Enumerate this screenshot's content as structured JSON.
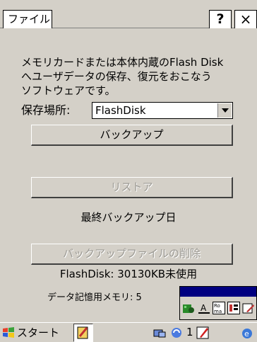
{
  "menu": {
    "file_label": "ファイル"
  },
  "titlebar": {
    "help_label": "?",
    "close_label": "×"
  },
  "description": "メモリカードまたは本体内蔵のFlash Disk\nへユーザデータの保存、復元をおこなう\nソフトウェアです。",
  "storage": {
    "label": "保存場所:",
    "selected": "FlashDisk"
  },
  "buttons": {
    "backup": "バックアップ",
    "restore": "リストア",
    "delete": "バックアップファイルの削除"
  },
  "status": {
    "last_backup_label": "最終バックアップ日",
    "free_space": "FlashDisk: 30130KB未使用",
    "data_memory": "データ記憶用メモリ: 5"
  },
  "input_panel": {
    "buttons": [
      "keyboard-icon",
      "a-char-icon",
      "roma-icon",
      "kana-icon",
      "pen-icon"
    ],
    "a_label": "A",
    "roma_label": "Ro\nma"
  },
  "taskbar": {
    "start_label": "スタート",
    "tray_number": "1",
    "accent": "#000080"
  }
}
